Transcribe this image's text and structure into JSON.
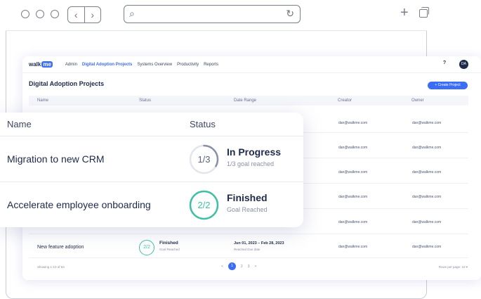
{
  "app": {
    "logo_text": "walk",
    "logo_badge": "me",
    "nav": [
      "Admin",
      "Digital Adoption Projects",
      "Systems Overview",
      "Productivity",
      "Reports"
    ],
    "active_nav": "Digital Adoption Projects",
    "help": "?",
    "avatar": "DA",
    "page_title": "Digital Adoption Projects",
    "create_button": "+ Create Project",
    "columns": [
      "Name",
      "Status",
      "Date Range",
      "Creator",
      "Owner"
    ],
    "rows": [
      {
        "creator": "dan@walkme.com",
        "owner": "dan@walkme.com"
      },
      {
        "creator": "dan@walkme.com",
        "owner": "dan@walkme.com"
      },
      {
        "creator": "dan@walkme.com",
        "owner": "dan@walkme.com"
      },
      {
        "creator": "dan@walkme.com",
        "owner": "dan@walkme.com"
      },
      {
        "creator": "dan@walkme.com",
        "owner": "dan@walkme.com"
      },
      {
        "name": "New feature adoption",
        "progress": "2/2",
        "status": "Finished",
        "status_sub": "Goal Reached",
        "date_range": "Jun 01, 2023 – Feb 28, 2023",
        "date_sub": "Reached Due date",
        "creator": "dan@walkme.com",
        "owner": "dan@walkme.com"
      }
    ],
    "showing": "Showing 1-10 of 53",
    "pages": [
      "<",
      "1",
      "2",
      "3",
      ">"
    ],
    "rows_per_page_label": "Rows per page:",
    "rows_per_page_value": "10 ▾"
  },
  "overlay": {
    "columns": [
      "Name",
      "Status"
    ],
    "rows": [
      {
        "name": "Migration to new CRM",
        "progress": "1/3",
        "fraction": 0.333,
        "status": "In Progress",
        "status_sub": "1/3 goal reached",
        "color": "#8a90a6"
      },
      {
        "name": "Accelerate employee onboarding",
        "progress": "2/2",
        "fraction": 1.0,
        "status": "Finished",
        "status_sub": "Goal Reached",
        "color": "#3fbfa3"
      }
    ]
  },
  "icons": {
    "back": "‹",
    "forward": "›",
    "search": "⌕",
    "reload": "↻",
    "new_tab": "+"
  }
}
